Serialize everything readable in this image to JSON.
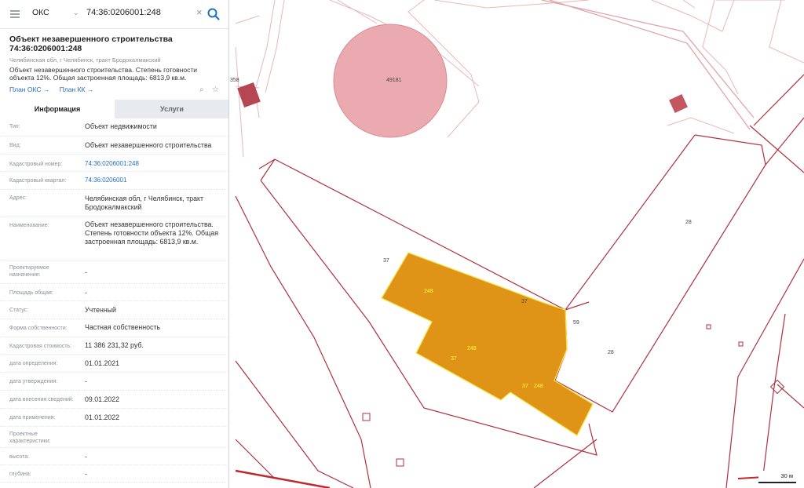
{
  "search": {
    "type_select": "ОКС",
    "query": "74:36:0206001:248"
  },
  "object": {
    "title": "Объект незавершенного строительства 74:36:0206001:248",
    "address": "Челябинская обл, г Челябинск, тракт Бродокалмакский",
    "description": "Объект незавершенного строительства. Степень готовности объекта 12%. Общая застроенная площадь: 6813,9 кв.м.",
    "link_plan_oks": "План ОКС →",
    "link_plan_kk": "План КК →"
  },
  "tabs": {
    "info": "Информация",
    "services": "Услуги"
  },
  "rows": [
    {
      "label": "Тип:",
      "value": "Объект недвижимости"
    },
    {
      "label": "Вид:",
      "value": "Объект незавершенного строительства"
    },
    {
      "label": "Кадастровый номер:",
      "value": "74:36:0206001:248",
      "link": true
    },
    {
      "label": "Кадастровый квартал:",
      "value": "74:36:0206001",
      "link": true
    },
    {
      "label": "Адрес:",
      "value": "Челябинская обл, г Челябинск, тракт Бродокалмакский"
    },
    {
      "label": "Наименование:",
      "value": "Объект незавершенного строительства. Степень готовности объекта 12%. Общая застроенная площадь: 6813,9 кв.м."
    },
    {
      "label": "Проектируемое назначение:",
      "value": "-"
    },
    {
      "label": "Площадь общая:",
      "value": "-"
    },
    {
      "label": "Статус:",
      "value": "Учтенный"
    },
    {
      "label": "Форма собственности:",
      "value": "Частная собственность"
    },
    {
      "label": "Кадастровая стоимость:",
      "value": "11 386 231,32 руб."
    },
    {
      "label": "дата определения:",
      "value": "01.01.2021"
    },
    {
      "label": "дата утверждения:",
      "value": "-"
    },
    {
      "label": "дата внесения сведений:",
      "value": "09.01.2022"
    },
    {
      "label": "дата применения:",
      "value": "01.01.2022"
    },
    {
      "label": "Проектные характеристики:",
      "value": ""
    },
    {
      "label": "высота:",
      "value": "-"
    },
    {
      "label": "глубина:",
      "value": "-"
    }
  ],
  "map": {
    "labels": {
      "circle": "49181",
      "l358": "358",
      "l28a": "28",
      "l28b": "28",
      "l37a": "37",
      "l37b": "37",
      "l59": "59",
      "b248a": "248",
      "b248b": "248",
      "b248c": "248",
      "b37a": "37",
      "b37b": "37"
    },
    "scale": "30 м"
  },
  "colors": {
    "accent": "#1f6fc5",
    "building": "#e09417",
    "boundary": "#b03040",
    "circle": "#ebaaaf"
  }
}
